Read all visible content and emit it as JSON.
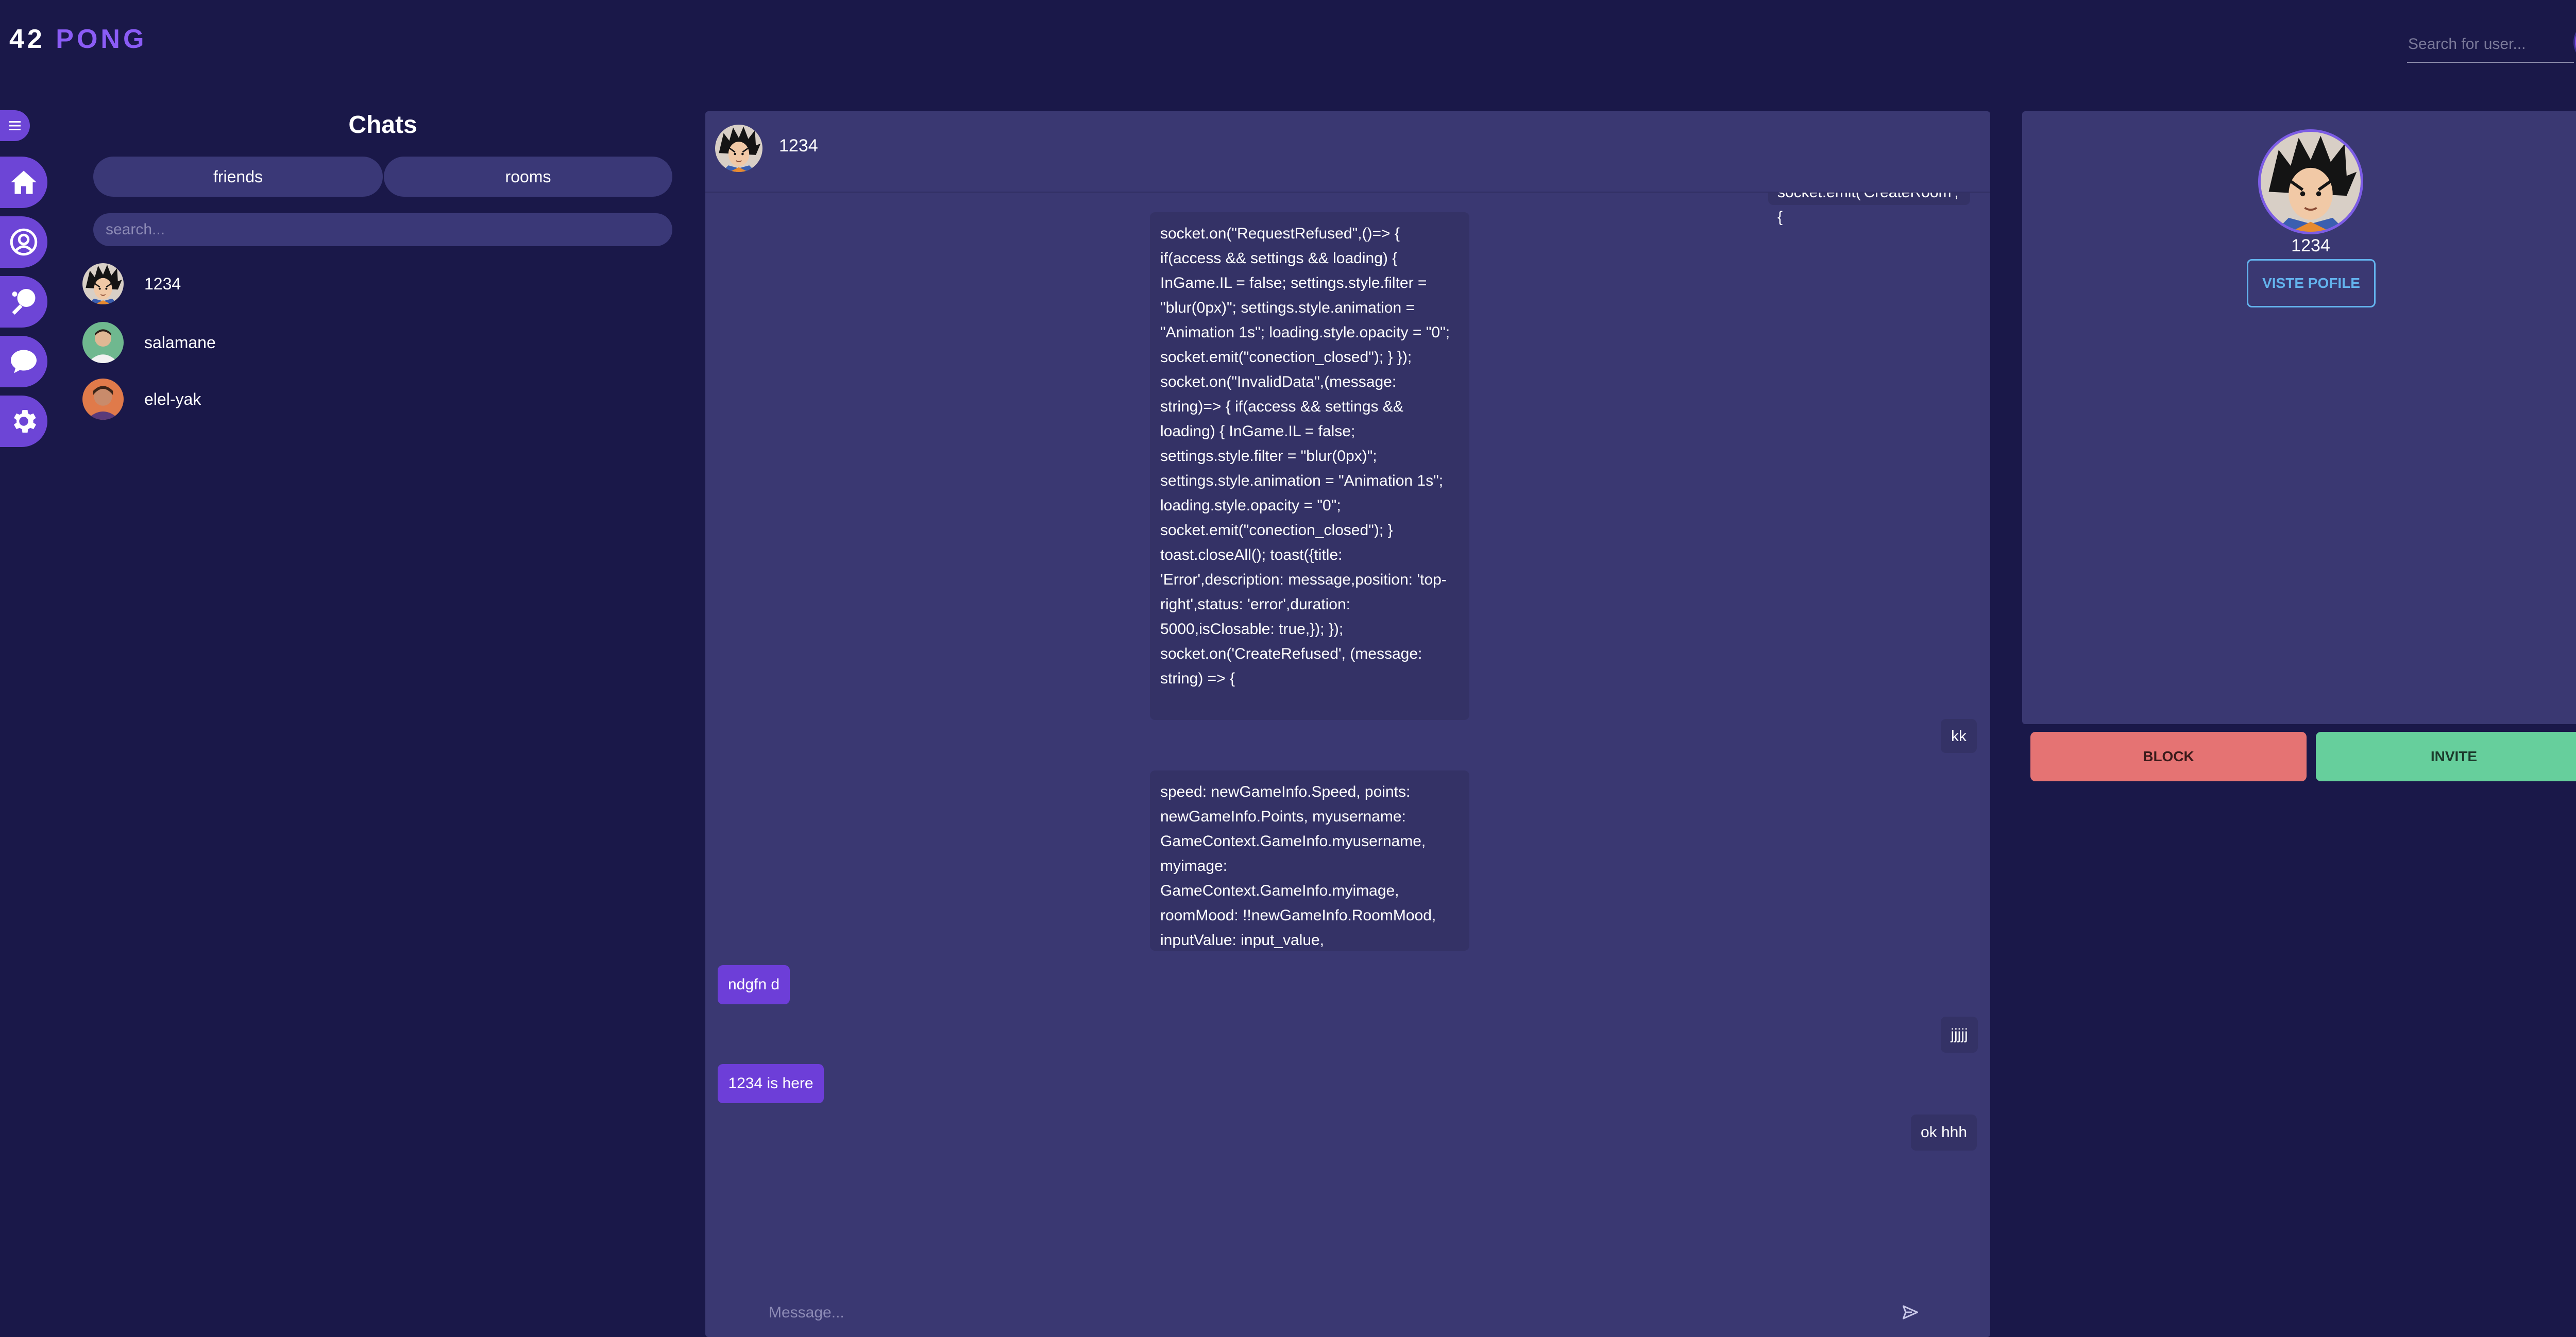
{
  "app": {
    "logo_number": "42",
    "logo_word": "PONG"
  },
  "header": {
    "search_placeholder": "Search for user..."
  },
  "sidebar": {
    "toggle_icon": "hamburger-icon",
    "items": [
      {
        "icon": "home-icon"
      },
      {
        "icon": "user-icon"
      },
      {
        "icon": "ping-pong-icon"
      },
      {
        "icon": "chat-icon"
      },
      {
        "icon": "gear-icon"
      }
    ]
  },
  "chats": {
    "title": "Chats",
    "tabs": [
      {
        "label": "friends"
      },
      {
        "label": "rooms"
      }
    ],
    "search_placeholder": "search...",
    "items": [
      {
        "name": "1234"
      },
      {
        "name": "salamane"
      },
      {
        "name": "elel-yak"
      }
    ]
  },
  "conversation": {
    "contact_name": "1234",
    "messages": [
      {
        "direction": "out",
        "text": "socket.emit('CreateRoom',{"
      },
      {
        "direction": "out",
        "text": "socket.on(\"RequestRefused\",()=> { if(access && settings && loading) { InGame.IL = false; settings.style.filter = \"blur(0px)\"; settings.style.animation = \"Animation 1s\"; loading.style.opacity = \"0\"; socket.emit(\"conection_closed\"); } }); socket.on(\"InvalidData\",(message: string)=> { if(access && settings && loading) { InGame.IL = false; settings.style.filter = \"blur(0px)\"; settings.style.animation = \"Animation 1s\"; loading.style.opacity = \"0\"; socket.emit(\"conection_closed\"); } toast.closeAll(); toast({title: 'Error',description: message,position: 'top-right',status: 'error',duration: 5000,isClosable: true,}); }); socket.on('CreateRefused', (message: string) => {"
      },
      {
        "direction": "out",
        "text": "kk"
      },
      {
        "direction": "out",
        "text": "speed: newGameInfo.Speed, points: newGameInfo.Points, myusername: GameContext.GameInfo.myusername, myimage: GameContext.GameInfo.myimage, roomMood: !!newGameInfo.RoomMood, inputValue: input_value,"
      },
      {
        "direction": "in",
        "text": "ndgfn d"
      },
      {
        "direction": "out",
        "text": "jjjjj"
      },
      {
        "direction": "in",
        "text": "1234 is here"
      },
      {
        "direction": "out",
        "text": "ok hhh"
      }
    ],
    "input_placeholder": "Message...",
    "send_icon": "send-icon"
  },
  "profile": {
    "name": "1234",
    "visit_label": "VISTE POFILE",
    "block_label": "BLOCK",
    "invite_label": "INVITE"
  },
  "colors": {
    "background": "#1a1849",
    "panel": "#3a3872",
    "accent": "#6d45d6",
    "logo_accent": "#8b5cf6",
    "block": "#e57373",
    "invite": "#66cf9c",
    "visit": "#63b3ed"
  }
}
